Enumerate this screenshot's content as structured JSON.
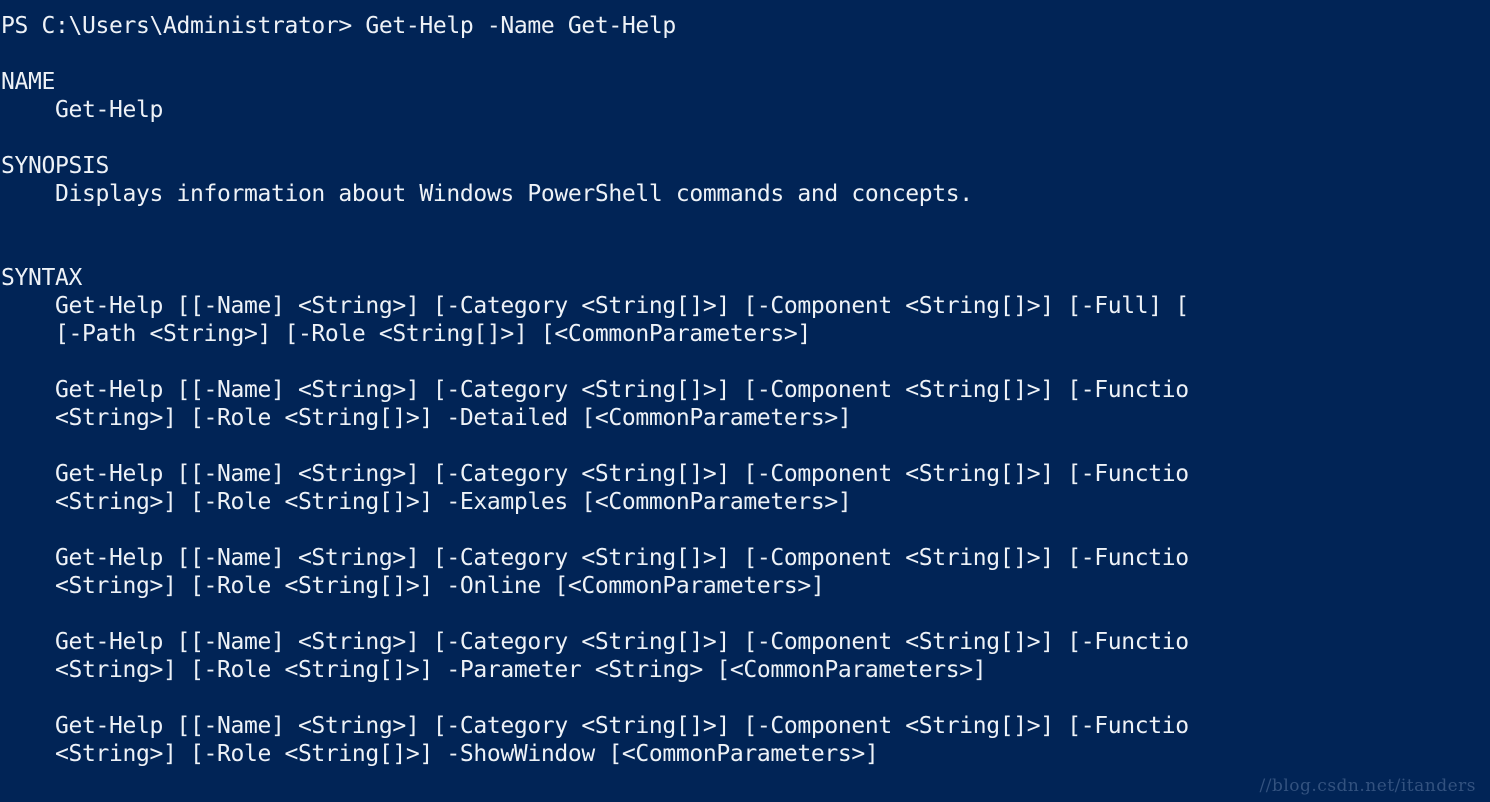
{
  "console": {
    "background_color": "#012456",
    "foreground_color": "#eef2f7",
    "prompt": "PS C:\\Users\\Administrator> Get-Help -Name Get-Help",
    "lines": [
      "PS C:\\Users\\Administrator> Get-Help -Name Get-Help",
      "",
      "NAME",
      "    Get-Help",
      "",
      "SYNOPSIS",
      "    Displays information about Windows PowerShell commands and concepts.",
      "",
      "",
      "SYNTAX",
      "    Get-Help [[-Name] <String>] [-Category <String[]>] [-Component <String[]>] [-Full] [",
      "    [-Path <String>] [-Role <String[]>] [<CommonParameters>]",
      "",
      "    Get-Help [[-Name] <String>] [-Category <String[]>] [-Component <String[]>] [-Functio",
      "    <String>] [-Role <String[]>] -Detailed [<CommonParameters>]",
      "",
      "    Get-Help [[-Name] <String>] [-Category <String[]>] [-Component <String[]>] [-Functio",
      "    <String>] [-Role <String[]>] -Examples [<CommonParameters>]",
      "",
      "    Get-Help [[-Name] <String>] [-Category <String[]>] [-Component <String[]>] [-Functio",
      "    <String>] [-Role <String[]>] -Online [<CommonParameters>]",
      "",
      "    Get-Help [[-Name] <String>] [-Category <String[]>] [-Component <String[]>] [-Functio",
      "    <String>] [-Role <String[]>] -Parameter <String> [<CommonParameters>]",
      "",
      "    Get-Help [[-Name] <String>] [-Category <String[]>] [-Component <String[]>] [-Functio",
      "    <String>] [-Role <String[]>] -ShowWindow [<CommonParameters>]"
    ],
    "sections": {
      "name_header": "NAME",
      "name_value": "Get-Help",
      "synopsis_header": "SYNOPSIS",
      "synopsis_value": "Displays information about Windows PowerShell commands and concepts.",
      "syntax_header": "SYNTAX"
    }
  },
  "watermark": {
    "text": "//blog.csdn.net/itanders",
    "color": "#33527f"
  }
}
